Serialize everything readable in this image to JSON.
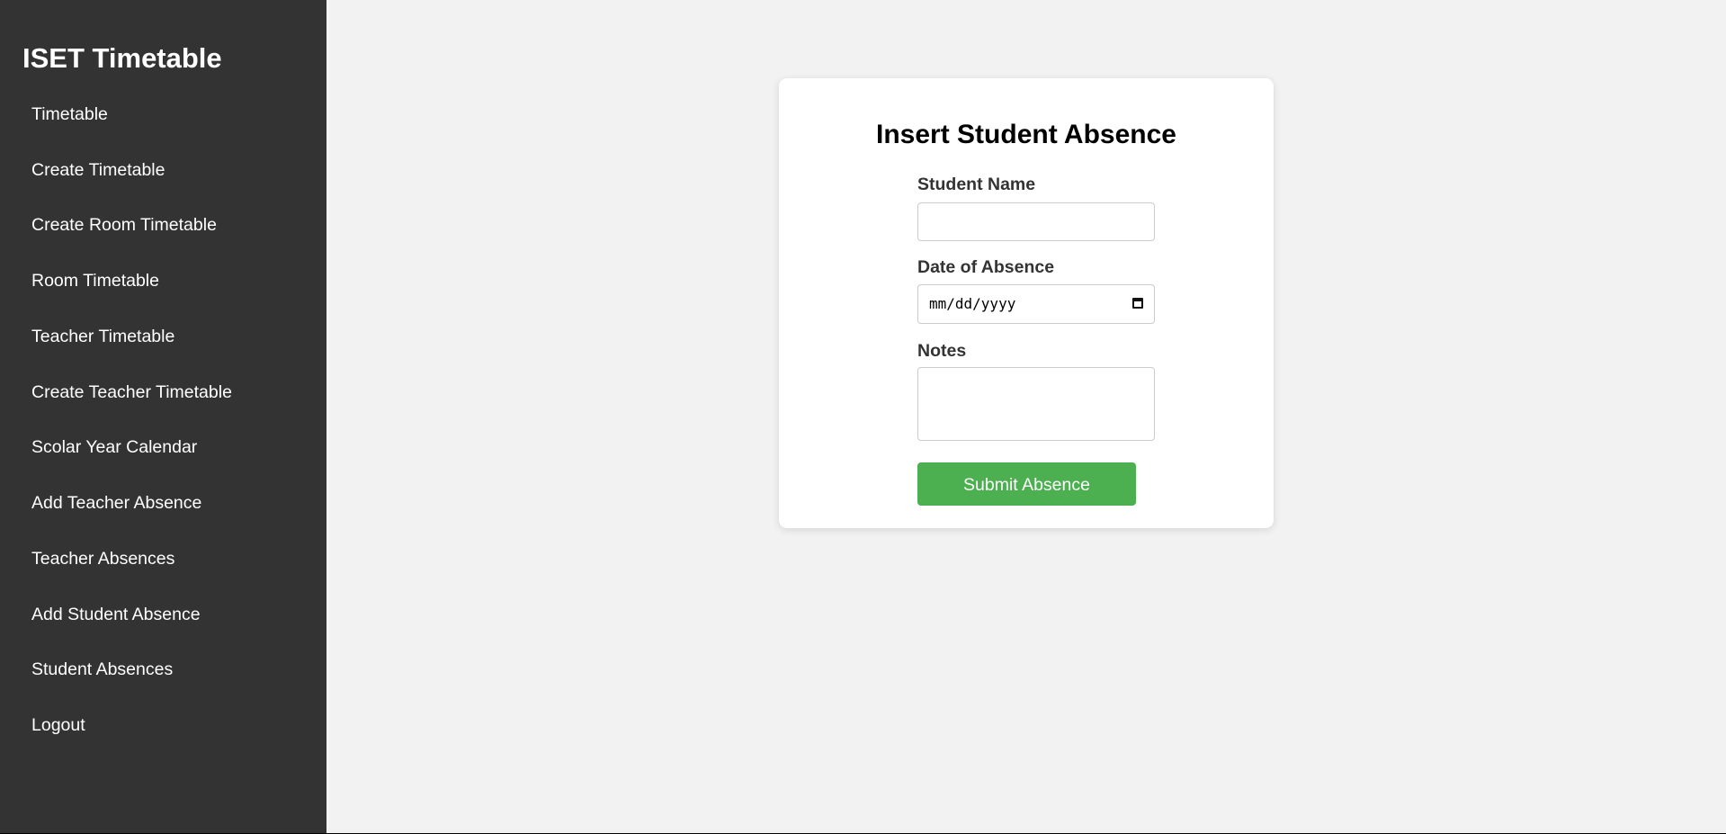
{
  "sidebar": {
    "title": "ISET Timetable",
    "items": [
      {
        "label": "Timetable"
      },
      {
        "label": "Create Timetable"
      },
      {
        "label": "Create Room Timetable"
      },
      {
        "label": "Room Timetable"
      },
      {
        "label": "Teacher Timetable"
      },
      {
        "label": "Create Teacher Timetable"
      },
      {
        "label": "Scolar Year Calendar"
      },
      {
        "label": "Add Teacher Absence"
      },
      {
        "label": "Teacher Absences"
      },
      {
        "label": "Add Student Absence"
      },
      {
        "label": "Student Absences"
      },
      {
        "label": "Logout"
      }
    ]
  },
  "form": {
    "title": "Insert Student Absence",
    "student_name_label": "Student Name",
    "student_name_value": "",
    "date_label": "Date of Absence",
    "date_placeholder": "mm/dd/yyyy",
    "notes_label": "Notes",
    "notes_value": "",
    "submit_label": "Submit Absence"
  },
  "colors": {
    "sidebar_bg": "#333333",
    "main_bg": "#f2f2f2",
    "button_bg": "#4caf50"
  }
}
